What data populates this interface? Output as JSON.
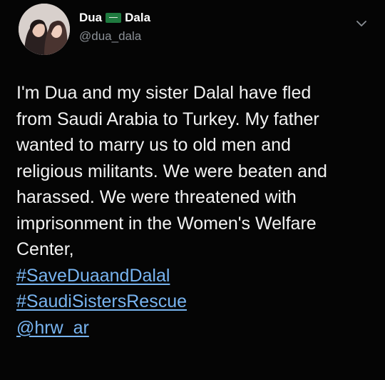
{
  "author": {
    "name_part1": "Dua",
    "name_part2": "Dala",
    "handle": "@dua_dala"
  },
  "icons": {
    "flag": "saudi-flag-icon",
    "menu": "chevron-down-icon"
  },
  "tweet": {
    "lines": [
      "I'm Dua and my sister Dalal have fled",
      "from Saudi Arabia to Turkey. My father",
      "wanted to marry us to old men and",
      "religious militants. We were beaten and",
      "harassed. We were threatened with",
      "imprisonment in the Women's Welfare",
      "Center,"
    ],
    "hashtags": [
      "#SaveDuaandDalal",
      "#SaudiSistersRescue"
    ],
    "mention": "@hrw_ar"
  },
  "colors": {
    "background": "#000000",
    "link": "#78b4f0",
    "text": "#f2f2f2",
    "secondary": "#8b9096"
  }
}
